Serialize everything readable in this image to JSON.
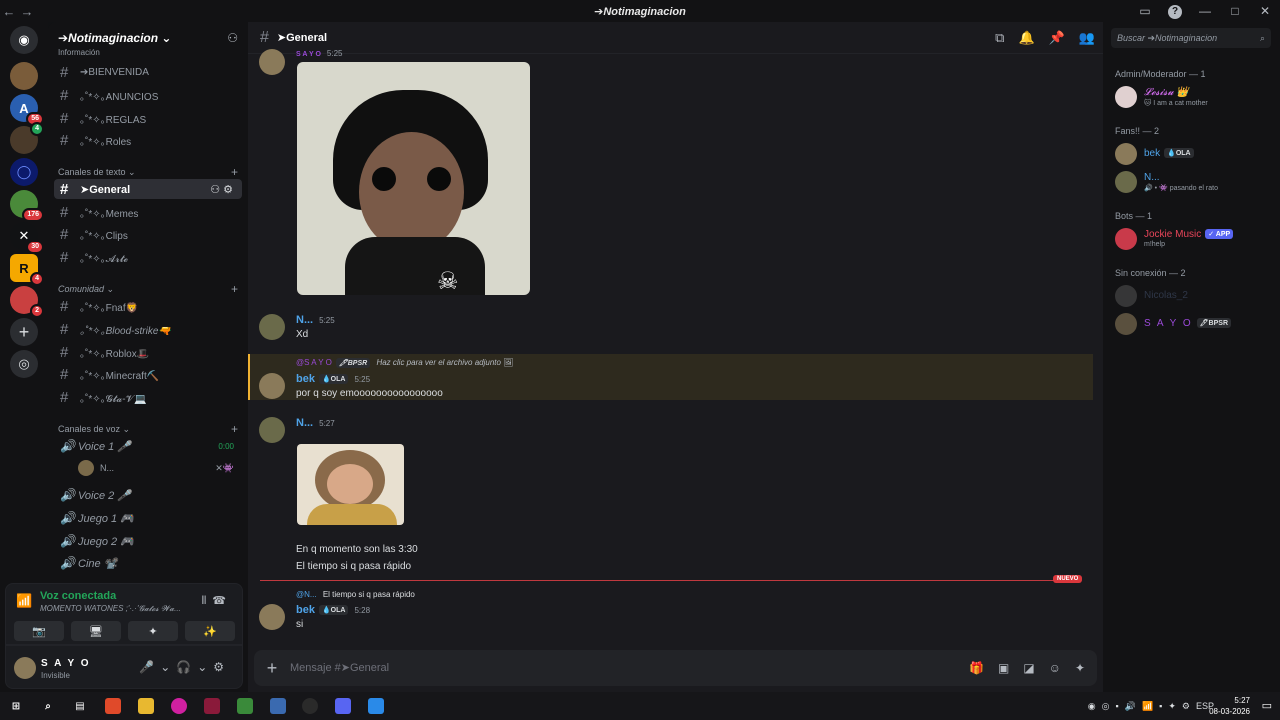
{
  "window": {
    "title": "➔Notimaginacion",
    "back_arrow": "←",
    "forward_arrow": "→",
    "controls": {
      "inbox": "▭",
      "help": "?",
      "minimize": "—",
      "maximize": "□",
      "close": "✕"
    }
  },
  "guilds": [
    {
      "kind": "home",
      "glyph": "◉",
      "color": "#2b2d31",
      "badge": ""
    },
    {
      "kind": "server",
      "glyph": "",
      "color": "#7a5c3a",
      "badge": ""
    },
    {
      "kind": "server",
      "glyph": "A",
      "color": "#2a5fb0",
      "badge": "56"
    },
    {
      "kind": "server",
      "glyph": "",
      "color": "#4a3a2a",
      "badge": "4"
    },
    {
      "kind": "server",
      "glyph": "◯",
      "color": "#0c1a6b",
      "badge": ""
    },
    {
      "kind": "server",
      "glyph": "",
      "color": "#4a8a3a",
      "badge": "176"
    },
    {
      "kind": "server",
      "glyph": "✕",
      "color": "#111214",
      "badge": "30"
    },
    {
      "kind": "server",
      "glyph": "R",
      "color": "#f5a800",
      "badge": "4"
    },
    {
      "kind": "server",
      "glyph": "",
      "color": "#c94040",
      "badge": "2"
    },
    {
      "kind": "add",
      "glyph": "+",
      "color": "#2b2d31",
      "badge": ""
    },
    {
      "kind": "discover",
      "glyph": "◎",
      "color": "#2b2d31",
      "badge": ""
    }
  ],
  "server": {
    "name": "➔Notimaginacion ⌄",
    "invite_icon": "⚇"
  },
  "channels": {
    "info_category": "Información",
    "info": [
      {
        "name": "➔BIENVENIDA"
      },
      {
        "name": "｡˚*✧｡ANUNCIOS"
      },
      {
        "name": "｡˚*✧｡REGLAS"
      },
      {
        "name": "｡˚*✧｡Roles"
      }
    ],
    "text_category": "Canales de texto ⌄",
    "text": [
      {
        "name": "➤General",
        "active": true
      },
      {
        "name": "｡˚*✧｡Memes",
        "active": false
      },
      {
        "name": "｡˚*✧｡Clips",
        "active": false
      },
      {
        "name": "｡˚*✧｡𝓐𝓻𝓽𝓮",
        "active": false
      }
    ],
    "community_category": "Comunidad ⌄",
    "community": [
      {
        "name": "｡˚*✧｡Fnaf🦁"
      },
      {
        "name": "｡˚*✧｡Blood-strike🔫"
      },
      {
        "name": "｡˚*✧｡Roblox🎩"
      },
      {
        "name": "｡˚*✧｡Minecraft⛏️"
      },
      {
        "name": "｡˚*✧｡𝓖𝓽𝓪-𝓥💻"
      }
    ],
    "voice_category": "Canales de voz ⌄",
    "voice": [
      {
        "name": "Voice 1 🎤",
        "timer": "0:00"
      },
      {
        "name": "Voice 2 🎤",
        "timer": ""
      },
      {
        "name": "Juego 1 🎮",
        "timer": ""
      },
      {
        "name": "Juego 2 🎮",
        "timer": ""
      },
      {
        "name": "Cine 📽️",
        "timer": ""
      }
    ],
    "voice_user": "N..."
  },
  "voice_panel": {
    "status": "Voz conectada",
    "location": "MOMENTO WATONES ;'·.·'𝓖𝓪𝓽𝓸𝓼 𝓦𝓪...",
    "buttons": [
      "📷",
      "🖥",
      "✦",
      "✨"
    ]
  },
  "user_panel": {
    "name": "S A Y O",
    "status": "Invisible"
  },
  "channel_header": {
    "name": "➤General"
  },
  "messages": [
    {
      "id": "m0",
      "author": "S A Y O",
      "time": "5:25",
      "text": ""
    },
    {
      "id": "m1",
      "author": "N...",
      "time": "5:25",
      "text": "Xd"
    },
    {
      "id": "m2",
      "author": "bek",
      "tag": "💧OLA",
      "time": "5:25",
      "text": "por q soy emoooooooooooooooo",
      "reply": {
        "author": "@S A Y O",
        "tag": "🖊BPSR",
        "text": "Haz clic para ver el archivo adjunto"
      }
    },
    {
      "id": "m3",
      "author": "N...",
      "time": "5:27",
      "text": ""
    },
    {
      "id": "m4",
      "text": "En q momento son las 3:30"
    },
    {
      "id": "m5",
      "text": "El tiempo si q pasa rápido"
    },
    {
      "id": "m6",
      "author": "bek",
      "tag": "💧OLA",
      "time": "5:28",
      "text": "si",
      "reply": {
        "author": "@N...",
        "text": "El tiempo si q pasa rápido"
      }
    }
  ],
  "new_badge": "NUEVO",
  "composer": {
    "placeholder": "Mensaje #➤General"
  },
  "members": {
    "search_placeholder": "Buscar ➔Notimaginacion",
    "groups": [
      {
        "label": "Admin/Moderador — 1",
        "members": [
          {
            "name": "𝓛𝓮𝓼𝓲𝓼𝓾 👑",
            "sub": "🐱 I am a cat mother",
            "color": "#d36df0"
          }
        ]
      },
      {
        "label": "Fans!! — 2",
        "members": [
          {
            "name": "bek",
            "tag": "💧OLA",
            "sub": "",
            "color": "#4fa3e8"
          },
          {
            "name": "N...",
            "sub": "🔊 • 👾 pasando el rato",
            "color": "#4fa3e8"
          }
        ]
      },
      {
        "label": "Bots — 1",
        "members": [
          {
            "name": "Jockie Music",
            "tag": "✓ APP",
            "sub": "m!help",
            "color": "#e8455a"
          }
        ]
      },
      {
        "label": "Sin conexión — 2",
        "members": [
          {
            "name": "Nicolas_2",
            "sub": "",
            "color": "#4a5a7a"
          },
          {
            "name": "S A Y O",
            "tag": "🖊BPSR",
            "sub": "",
            "color": "#9a4ad8"
          }
        ]
      }
    ]
  },
  "taskbar": {
    "lang": "ESP",
    "time": "5:27",
    "date": "08-03-2026"
  },
  "colors": {
    "accent": "#5865f2",
    "online": "#23a559",
    "danger": "#da373c"
  }
}
